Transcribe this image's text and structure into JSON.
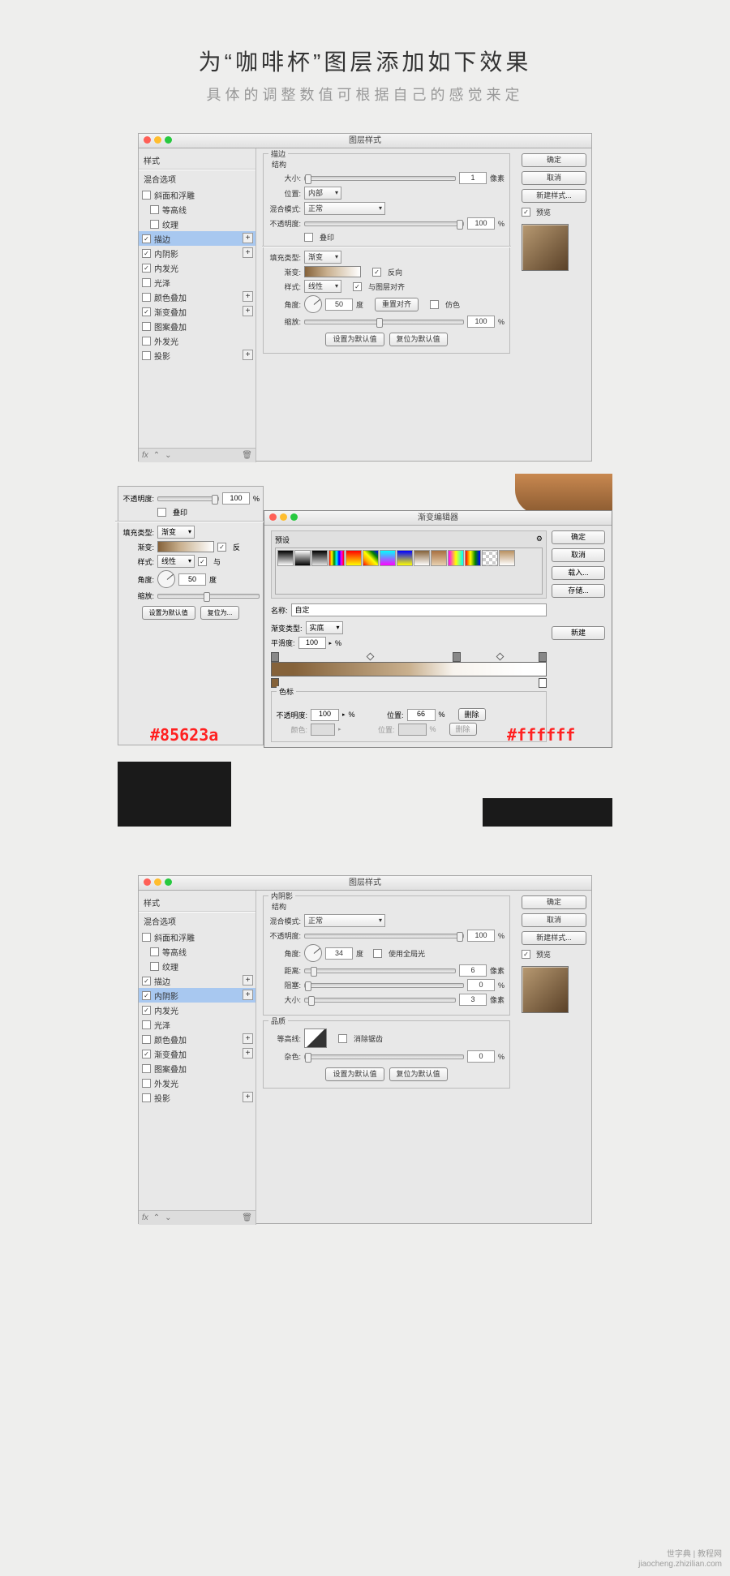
{
  "heading": {
    "main": "为“咖啡杯”图层添加如下效果",
    "sub": "具体的调整数值可根据自己的感觉来定"
  },
  "d1": {
    "title": "图层样式",
    "styles_header": "样式",
    "blend_header": "混合选项",
    "items": [
      {
        "label": "斜面和浮雕",
        "checked": false,
        "plus": false,
        "indent": false
      },
      {
        "label": "等高线",
        "checked": false,
        "plus": false,
        "indent": true
      },
      {
        "label": "纹理",
        "checked": false,
        "plus": false,
        "indent": true
      },
      {
        "label": "描边",
        "checked": true,
        "plus": true,
        "selected": true,
        "indent": false
      },
      {
        "label": "内阴影",
        "checked": true,
        "plus": true,
        "indent": false
      },
      {
        "label": "内发光",
        "checked": true,
        "plus": false,
        "indent": false
      },
      {
        "label": "光泽",
        "checked": false,
        "plus": false,
        "indent": false
      },
      {
        "label": "颜色叠加",
        "checked": false,
        "plus": true,
        "indent": false
      },
      {
        "label": "渐变叠加",
        "checked": true,
        "plus": true,
        "indent": false
      },
      {
        "label": "图案叠加",
        "checked": false,
        "plus": false,
        "indent": false
      },
      {
        "label": "外发光",
        "checked": false,
        "plus": false,
        "indent": false
      },
      {
        "label": "投影",
        "checked": false,
        "plus": true,
        "indent": false
      }
    ],
    "panel_title": "描边",
    "struct": "结构",
    "size_label": "大小:",
    "size_val": "1",
    "size_unit": "像素",
    "pos_label": "位置:",
    "pos_val": "内部",
    "blend_label": "混合模式:",
    "blend_val": "正常",
    "opacity_label": "不透明度:",
    "opacity_val": "100",
    "opacity_unit": "%",
    "overprint": "叠印",
    "filltype_label": "填充类型:",
    "filltype_val": "渐变",
    "grad_label": "渐变:",
    "reverse": "反向",
    "style_label": "样式:",
    "style_val": "线性",
    "align_layer": "与图层对齐",
    "angle_label": "角度:",
    "angle_val": "50",
    "angle_unit": "度",
    "reset_align": "重置对齐",
    "dither": "仿色",
    "scale_label": "缩放:",
    "scale_val": "100",
    "scale_unit": "%",
    "set_default": "设置为默认值",
    "reset_default": "复位为默认值",
    "ok": "确定",
    "cancel": "取消",
    "new_style": "新建样式...",
    "preview": "预览"
  },
  "s2": {
    "bg_opacity_lbl": "不透明度:",
    "bg_opacity_val": "100",
    "bg_overprint": "叠印",
    "bg_fill_lbl": "填充类型:",
    "bg_fill_val": "渐变",
    "bg_grad_lbl": "渐变:",
    "bg_style_lbl": "样式:",
    "bg_style_val": "线性",
    "bg_angle_lbl": "角度:",
    "bg_angle_val": "50",
    "bg_angle_unit": "度",
    "bg_scale_lbl": "缩放:",
    "bg_set_def": "设置为默认值",
    "bg_reset_def": "复位为...",
    "ge_title": "渐变编辑器",
    "presets": "预设",
    "name_lbl": "名称:",
    "name_val": "自定",
    "new_btn": "新建",
    "gtype_lbl": "渐变类型:",
    "gtype_val": "实底",
    "smooth_lbl": "平滑度:",
    "smooth_val": "100",
    "smooth_unit": "%",
    "color_stops": "色标",
    "op_lbl": "不透明度:",
    "op_val": "100",
    "op_unit": "%",
    "pos_lbl": "位置:",
    "pos_val": "66",
    "pos_unit": "%",
    "delete": "删除",
    "color_lbl": "颜色:",
    "pos2_lbl": "位置:",
    "delete2": "删除",
    "ok": "确定",
    "cancel": "取消",
    "load": "载入...",
    "save": "存储...",
    "hex1": "#85623a",
    "hex2": "#ffffff"
  },
  "d3": {
    "title": "图层样式",
    "styles_header": "样式",
    "blend_header": "混合选项",
    "items": [
      {
        "label": "斜面和浮雕",
        "checked": false,
        "plus": false
      },
      {
        "label": "等高线",
        "checked": false,
        "plus": false,
        "indent": true
      },
      {
        "label": "纹理",
        "checked": false,
        "plus": false,
        "indent": true
      },
      {
        "label": "描边",
        "checked": true,
        "plus": true
      },
      {
        "label": "内阴影",
        "checked": true,
        "plus": true,
        "selected": true
      },
      {
        "label": "内发光",
        "checked": true,
        "plus": false
      },
      {
        "label": "光泽",
        "checked": false,
        "plus": false
      },
      {
        "label": "颜色叠加",
        "checked": false,
        "plus": true
      },
      {
        "label": "渐变叠加",
        "checked": true,
        "plus": true
      },
      {
        "label": "图案叠加",
        "checked": false,
        "plus": false
      },
      {
        "label": "外发光",
        "checked": false,
        "plus": false
      },
      {
        "label": "投影",
        "checked": false,
        "plus": true
      }
    ],
    "panel_title": "内阴影",
    "struct": "结构",
    "blend_label": "混合模式:",
    "blend_val": "正常",
    "opacity_label": "不透明度:",
    "opacity_val": "100",
    "opacity_unit": "%",
    "angle_label": "角度:",
    "angle_val": "34",
    "angle_unit": "度",
    "global_light": "使用全局光",
    "dist_label": "距离:",
    "dist_val": "6",
    "dist_unit": "像素",
    "choke_label": "阻塞:",
    "choke_val": "0",
    "choke_unit": "%",
    "size_label": "大小:",
    "size_val": "3",
    "size_unit": "像素",
    "quality": "品质",
    "contour_label": "等高线:",
    "anti_alias": "消除锯齿",
    "noise_label": "杂色:",
    "noise_val": "0",
    "noise_unit": "%",
    "set_default": "设置为默认值",
    "reset_default": "复位为默认值",
    "ok": "确定",
    "cancel": "取消",
    "new_style": "新建样式...",
    "preview": "预览"
  },
  "watermark": {
    "l1": "世字典 | 教程网",
    "l2": "jiaocheng.zhizilian.com"
  }
}
